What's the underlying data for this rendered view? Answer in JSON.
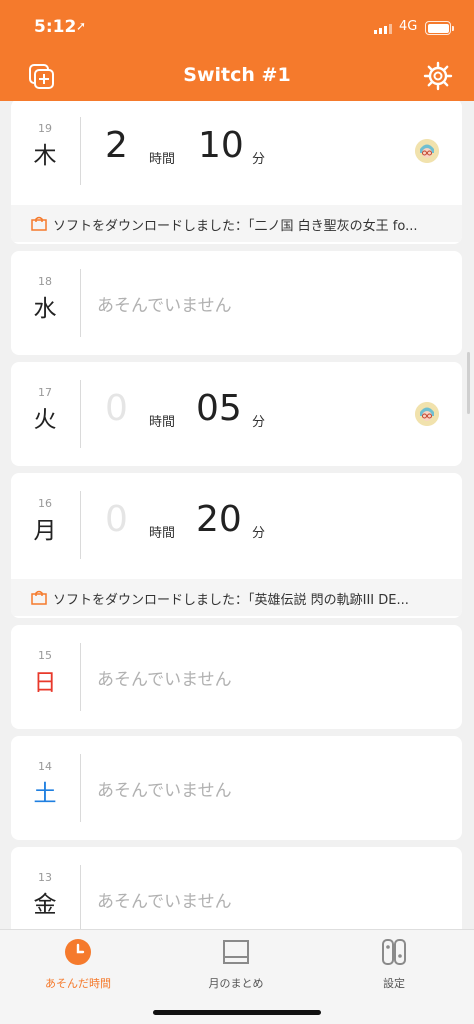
{
  "status_bar": {
    "time": "5:12",
    "network": "4G"
  },
  "nav": {
    "title": "Switch #1"
  },
  "days": [
    {
      "num": "19",
      "weekday": "木",
      "hours": "2",
      "hours_unit": "時間",
      "minutes": "10",
      "minutes_unit": "分",
      "banner": "ソフトをダウンロードしました：「二ノ国 白き聖灰の女王 fo..."
    },
    {
      "num": "18",
      "weekday": "水",
      "none": "あそんでいません"
    },
    {
      "num": "17",
      "weekday": "火",
      "hours": "0",
      "hours_unit": "時間",
      "minutes": "05",
      "minutes_unit": "分"
    },
    {
      "num": "16",
      "weekday": "月",
      "hours": "0",
      "hours_unit": "時間",
      "minutes": "20",
      "minutes_unit": "分",
      "banner": "ソフトをダウンロードしました：「英雄伝説 閃の軌跡III DE..."
    },
    {
      "num": "15",
      "weekday": "日",
      "none": "あそんでいません",
      "color": "#e8392b"
    },
    {
      "num": "14",
      "weekday": "土",
      "none": "あそんでいません",
      "color": "#1f7fe0"
    },
    {
      "num": "13",
      "weekday": "金",
      "none": "あそんでいません"
    }
  ],
  "tabs": [
    {
      "label": "あそんだ時間",
      "icon": "clock-icon",
      "active": true
    },
    {
      "label": "月のまとめ",
      "icon": "calendar-icon",
      "active": false
    },
    {
      "label": "設定",
      "icon": "switch-console-icon",
      "active": false
    }
  ],
  "colors": {
    "accent": "#f57a2c",
    "sunday": "#e8392b",
    "saturday": "#1f7fe0"
  }
}
